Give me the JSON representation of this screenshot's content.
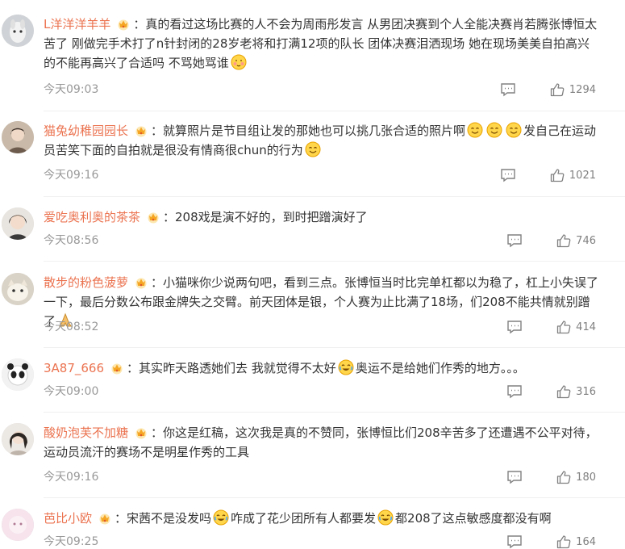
{
  "comments": [
    {
      "user": "L洋洋洋羊羊",
      "parts": [
        {
          "t": "：真的看过这场比赛的人不会为周雨彤发言 从男团决赛到个人全能决赛肖若腾张博恒太苦了 刚做完手术打了n针封闭的28岁老将和打满12项的队长 团体决赛泪洒现场 她在现场美美自拍高兴的不能再高兴了合适吗 不骂她骂谁"
        },
        {
          "e": "shy-face"
        }
      ],
      "time": "今天09:03",
      "likes": "1294"
    },
    {
      "user": "猫兔幼稚园园长",
      "parts": [
        {
          "t": "：就算照片是节目组让发的那她也可以挑几张合适的照片啊"
        },
        {
          "e": "smile-face"
        },
        {
          "e": "smile-face"
        },
        {
          "e": "smile-face"
        },
        {
          "t": "发自己在运动员苦笑下面的自拍就是很没有情商很chun的行为"
        },
        {
          "e": "smile-face"
        }
      ],
      "time": "今天09:16",
      "likes": "1021"
    },
    {
      "user": "爱吃奥利奥的茶茶",
      "parts": [
        {
          "t": "：208戏是演不好的，到时把蹭演好了"
        }
      ],
      "time": "今天08:56",
      "likes": "746"
    },
    {
      "user": "散步的粉色菠萝",
      "parts": [
        {
          "t": "：小猫咪你少说两句吧，看到三点。张博恒当时比完单杠都以为稳了，杠上小失误了一下，最后分数公布跟金牌失之交臂。前天团体是银，个人赛为止比满了18场，们208不能共情就别蹭了"
        },
        {
          "e": "pray"
        }
      ],
      "time": "今天08:52",
      "likes": "414"
    },
    {
      "user": "3A87_666",
      "parts": [
        {
          "t": "：其实昨天路透她们去 我就觉得不太好"
        },
        {
          "e": "laugh-cry"
        },
        {
          "t": "奥运不是给她们作秀的地方。。。"
        }
      ],
      "time": "今天09:00",
      "likes": "316"
    },
    {
      "user": "酸奶泡芙不加糖",
      "parts": [
        {
          "t": "：你这是红稿，这次我是真的不赞同，张博恒比们208辛苦多了还遭遇不公平对待，运动员流汗的赛场不是明星作秀的工具"
        }
      ],
      "time": "今天09:16",
      "likes": "180"
    },
    {
      "user": "芭比小欧",
      "parts": [
        {
          "t": "：宋茜不是没发吗"
        },
        {
          "e": "laugh-cry"
        },
        {
          "t": "咋成了花少团所有人都要发"
        },
        {
          "e": "laugh-cry"
        },
        {
          "t": "都208了这点敏感度都没有啊"
        }
      ],
      "time": "今天09:25",
      "likes": "164"
    }
  ],
  "colors": {
    "username": "#eb7350",
    "text": "#333333",
    "meta": "#999999",
    "badge": "#f5a623"
  },
  "icons": {
    "badge": "crown-badge-icon",
    "reply": "reply-icon",
    "like": "thumb-up-icon"
  }
}
